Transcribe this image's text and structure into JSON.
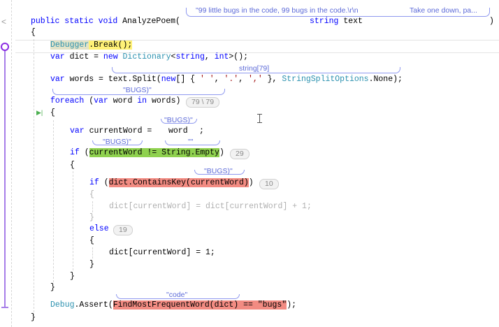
{
  "editor": {
    "collapse_glyph": "<",
    "run_to_here_glyph": "▶|",
    "lines": [
      [
        {
          "t": "public static void ",
          "c": "kw"
        },
        {
          "t": "AnalyzePoem(",
          "c": "pl"
        }
      ],
      [
        {
          "t": "string ",
          "c": "kw"
        },
        {
          "t": "text",
          "c": "pl"
        }
      ],
      [
        {
          "t": ")",
          "c": "pl"
        }
      ],
      [
        {
          "t": "{",
          "c": "pl"
        }
      ],
      [
        {
          "t": "Debugger",
          "c": "ty hl-dbg"
        },
        {
          "t": ".Break();",
          "c": "pl hl-yel"
        }
      ],
      [
        {
          "t": "var ",
          "c": "kw"
        },
        {
          "t": "dict = ",
          "c": "pl"
        },
        {
          "t": "new ",
          "c": "kw"
        },
        {
          "t": "Dictionary",
          "c": "ty"
        },
        {
          "t": "<",
          "c": "pl"
        },
        {
          "t": "string",
          "c": "kw"
        },
        {
          "t": ", ",
          "c": "pl"
        },
        {
          "t": "int",
          "c": "kw"
        },
        {
          "t": ">();",
          "c": "pl"
        }
      ],
      [
        {
          "t": "var ",
          "c": "kw"
        },
        {
          "t": "words = text.Split(",
          "c": "pl"
        },
        {
          "t": "new",
          "c": "kw"
        },
        {
          "t": "[] { ",
          "c": "pl"
        },
        {
          "t": "' '",
          "c": "ch"
        },
        {
          "t": ", ",
          "c": "pl"
        },
        {
          "t": "'.'",
          "c": "ch"
        },
        {
          "t": ", ",
          "c": "pl"
        },
        {
          "t": "','",
          "c": "ch"
        },
        {
          "t": " }, ",
          "c": "pl"
        },
        {
          "t": "StringSplitOptions",
          "c": "ty"
        },
        {
          "t": ".None);",
          "c": "pl"
        }
      ],
      [
        {
          "t": "foreach ",
          "c": "kw"
        },
        {
          "t": "(",
          "c": "pl"
        },
        {
          "t": "var ",
          "c": "kw"
        },
        {
          "t": "word ",
          "c": "pl"
        },
        {
          "t": "in ",
          "c": "kw"
        },
        {
          "t": "words)",
          "c": "pl"
        }
      ],
      [
        {
          "t": "{",
          "c": "pl"
        }
      ],
      [
        {
          "t": "var ",
          "c": "kw"
        },
        {
          "t": "currentWord =",
          "c": "pl"
        }
      ],
      [
        {
          "t": "word",
          "c": "pl"
        }
      ],
      [
        {
          "t": ";",
          "c": "pl"
        }
      ],
      [
        {
          "t": "if ",
          "c": "kw"
        },
        {
          "t": "(",
          "c": "pl"
        },
        {
          "t": "currentWord != String.Empty",
          "c": "pl hl-green"
        },
        {
          "t": ")",
          "c": "pl"
        }
      ],
      [
        {
          "t": "{",
          "c": "pl"
        }
      ],
      [
        {
          "t": "if ",
          "c": "kw"
        },
        {
          "t": "(",
          "c": "pl"
        },
        {
          "t": "dict.ContainsKey(currentWord)",
          "c": "pl hl-red"
        },
        {
          "t": ")",
          "c": "pl"
        }
      ],
      [
        {
          "t": "{",
          "c": "gr"
        }
      ],
      [
        {
          "t": "dict[currentWord] = dict[currentWord] + 1;",
          "c": "gr"
        }
      ],
      [
        {
          "t": "}",
          "c": "gr"
        }
      ],
      [
        {
          "t": "else",
          "c": "kw"
        }
      ],
      [
        {
          "t": "{",
          "c": "pl"
        }
      ],
      [
        {
          "t": "dict[currentWord] = 1;",
          "c": "pl"
        }
      ],
      [
        {
          "t": "}",
          "c": "pl"
        }
      ],
      [
        {
          "t": "}",
          "c": "pl"
        }
      ],
      [
        {
          "t": "}",
          "c": "pl"
        }
      ],
      [
        {
          "t": "Debug",
          "c": "ty"
        },
        {
          "t": ".Assert(",
          "c": "pl"
        },
        {
          "t": "FindMostFrequentWord(dict) == \"bugs\"",
          "c": "pl hl-red"
        },
        {
          "t": ");",
          "c": "pl"
        }
      ],
      [
        {
          "t": "}",
          "c": "pl"
        }
      ]
    ],
    "hit_counts": [
      "79 \\ 79",
      "29",
      "10",
      "19"
    ],
    "datatips": [
      "\"99 little bugs in the code, 99 bugs in the code.\\r\\n",
      "Take one down, pa...",
      "string[79]",
      "\"BUGS)\"",
      "\"BUGS)\"",
      "\"BUGS)\"",
      "\"\"",
      "\"BUGS)\"",
      "\"code\""
    ]
  }
}
